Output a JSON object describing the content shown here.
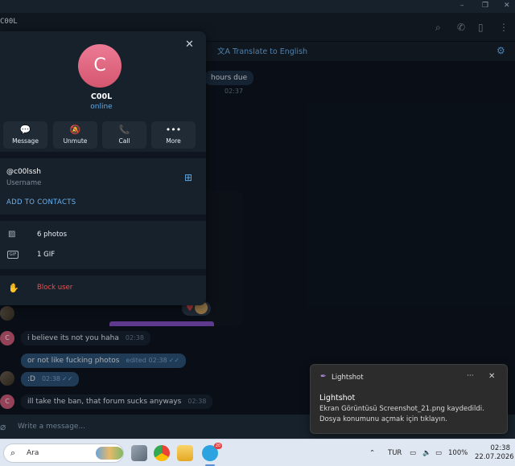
{
  "window": {
    "chat_title": "C00L",
    "controls": [
      "–",
      "❐",
      "✕"
    ]
  },
  "header": {
    "translate_label": "Translate to English"
  },
  "chat": {
    "partial_message": "hours due",
    "partial_time": "02:37",
    "messages": [
      {
        "text": "i believe its not you haha",
        "time": "02:38",
        "edited": "",
        "direction": "in"
      },
      {
        "text": "or not like fucking photos",
        "time": "02:38",
        "edited": "edited",
        "direction": "out"
      },
      {
        "text": ":D",
        "time": "02:38",
        "edited": "",
        "direction": "out"
      },
      {
        "text": "ill take the ban, that forum sucks anyways",
        "time": "02:38",
        "edited": "",
        "direction": "in"
      }
    ],
    "avatar_letter": "C",
    "composer_placeholder": "Write a message..."
  },
  "profile": {
    "avatar_letter": "C",
    "name": "C00L",
    "status": "online",
    "actions": [
      {
        "label": "Message",
        "icon": "message-icon",
        "glyph": "💬"
      },
      {
        "label": "Unmute",
        "icon": "bell-off-icon",
        "glyph": "🔕"
      },
      {
        "label": "Call",
        "icon": "phone-icon",
        "glyph": "📞"
      },
      {
        "label": "More",
        "icon": "more-icon",
        "glyph": "•••"
      }
    ],
    "username": "@c00lssh",
    "username_label": "Username",
    "add_contacts": "ADD TO CONTACTS",
    "photos": "6 photos",
    "gifs": "1 GIF",
    "gif_icon_text": "GIF",
    "block": "Block user"
  },
  "notification": {
    "app": "Lightshot",
    "title": "Lightshot",
    "line1": "Ekran Görüntüsü Screenshot_21.png kaydedildi.",
    "line2": "Dosya konumunu açmak için tıklayın."
  },
  "taskbar": {
    "search_label": "Ara",
    "telegram_badge": "20",
    "language": "TUR",
    "battery": "100%",
    "time": "02:38",
    "date": "22.07.2026"
  },
  "colors": {
    "accent": "#6ab2f2",
    "danger": "#e05454",
    "avatar": "#e0647f"
  }
}
